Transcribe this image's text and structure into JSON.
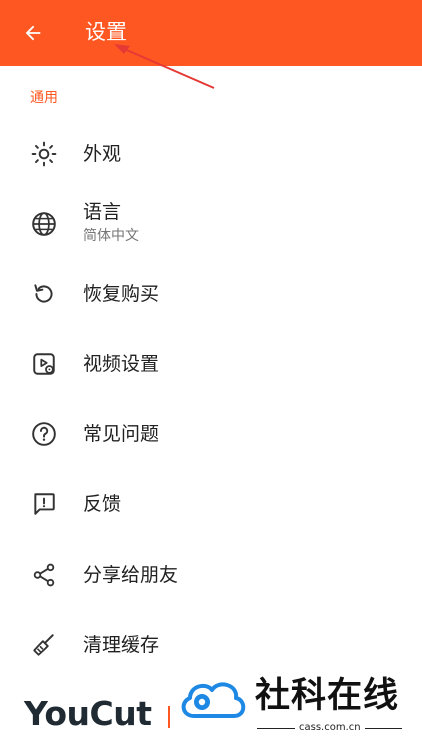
{
  "appbar": {
    "title": "设置",
    "back_icon": "arrow-left-icon",
    "color": "#ff5722"
  },
  "section": {
    "header": "通用",
    "color": "#ff5722"
  },
  "settings": {
    "items": [
      {
        "label": "外观",
        "icon": "sun-icon"
      },
      {
        "label": "语言",
        "subtitle": "简体中文",
        "icon": "globe-icon"
      },
      {
        "label": "恢复购买",
        "icon": "restore-icon"
      },
      {
        "label": "视频设置",
        "icon": "video-settings-icon"
      },
      {
        "label": "常见问题",
        "icon": "help-circle-icon"
      },
      {
        "label": "反馈",
        "icon": "feedback-icon"
      },
      {
        "label": "分享给朋友",
        "icon": "share-icon"
      },
      {
        "label": "清理缓存",
        "icon": "broom-icon"
      }
    ]
  },
  "watermark": {
    "app_logo": "YouCut",
    "site_name": "社科在线",
    "site_url": "cass.com.cn"
  }
}
